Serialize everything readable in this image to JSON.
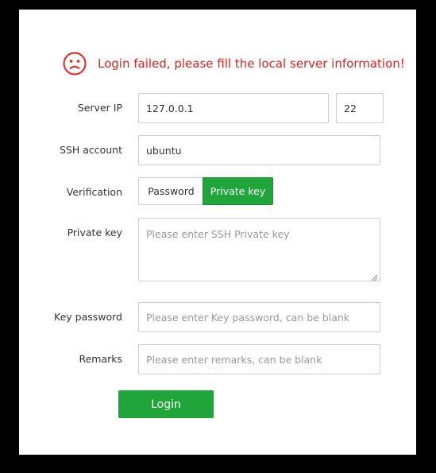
{
  "error": {
    "icon": "sad-face-icon",
    "message": "Login failed, please fill the local server information!",
    "color": "#e8211d"
  },
  "form": {
    "server_ip": {
      "label": "Server IP",
      "value": "127.0.0.1",
      "port": "22"
    },
    "ssh_account": {
      "label": "SSH account",
      "value": "ubuntu"
    },
    "verification": {
      "label": "Verification",
      "options": [
        "Password",
        "Private key"
      ],
      "selected": "Private key"
    },
    "private_key": {
      "label": "Private key",
      "placeholder": "Please enter SSH Private key"
    },
    "key_password": {
      "label": "Key password",
      "placeholder": "Please enter Key password, can be blank"
    },
    "remarks": {
      "label": "Remarks",
      "placeholder": "Please enter remarks, can be blank"
    }
  },
  "login_button": "Login",
  "accent_color": "#20a53a"
}
